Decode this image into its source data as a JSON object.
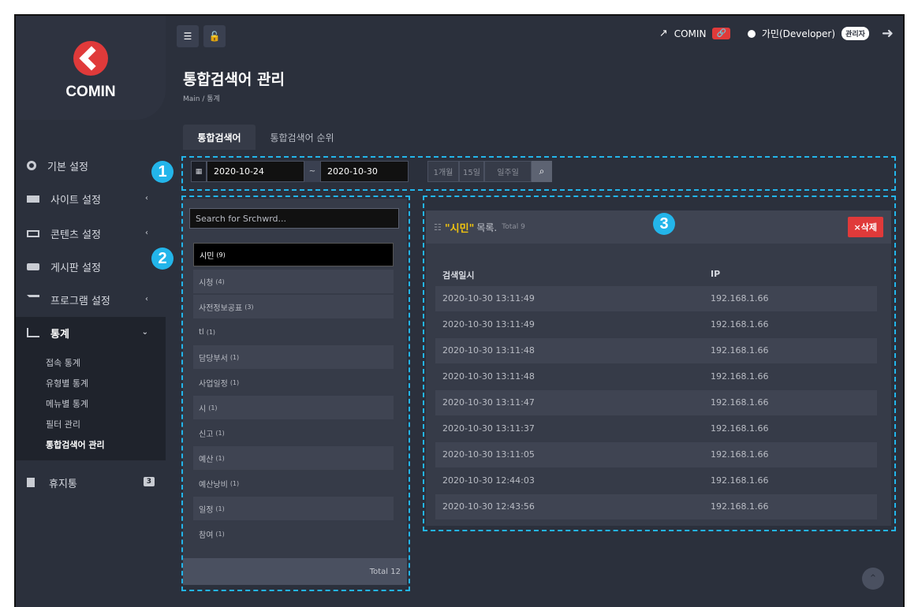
{
  "brand": {
    "name": "COMIN"
  },
  "sidebar": {
    "items": [
      {
        "label": "기본 설정"
      },
      {
        "label": "사이트 설정",
        "chevron": "‹"
      },
      {
        "label": "콘텐츠 설정",
        "chevron": "‹"
      },
      {
        "label": "게시판 설정"
      },
      {
        "label": "프로그램 설정",
        "chevron": "‹"
      },
      {
        "label": "통계",
        "chevron": "⌄"
      },
      {
        "label": "휴지통",
        "badge": "3"
      }
    ],
    "submenu": [
      "접속 통계",
      "유형별 통계",
      "메뉴별 통계",
      "필터 관리",
      "통합검색어 관리"
    ]
  },
  "topbar": {
    "site_link": "COMIN",
    "user_name": "가민(Developer)",
    "role": "관리자"
  },
  "page": {
    "title": "통합검색어 관리",
    "breadcrumb": "Main  /  통계"
  },
  "tabs": [
    "통합검색어",
    "통합검색어 순위"
  ],
  "filter": {
    "start_date": "2020-10-24",
    "separator": "~",
    "end_date": "2020-10-30",
    "ranges": [
      "1개월",
      "15일",
      "일주일"
    ]
  },
  "keyword_panel": {
    "search_placeholder": "Search for Srchwrd...",
    "items": [
      {
        "word": "시민",
        "count": "(9)"
      },
      {
        "word": "시청",
        "count": "(4)"
      },
      {
        "word": "사전정보공표",
        "count": "(3)"
      },
      {
        "word": "tl",
        "count": "(1)"
      },
      {
        "word": "담당부서",
        "count": "(1)"
      },
      {
        "word": "사업일정",
        "count": "(1)"
      },
      {
        "word": "시",
        "count": "(1)"
      },
      {
        "word": "신고",
        "count": "(1)"
      },
      {
        "word": "예산",
        "count": "(1)"
      },
      {
        "word": "예산낭비",
        "count": "(1)"
      },
      {
        "word": "일정",
        "count": "(1)"
      },
      {
        "word": "참여",
        "count": "(1)"
      }
    ],
    "footer_total": "Total 12"
  },
  "detail": {
    "keyword": "\"시민\"",
    "list_word": "목록.",
    "total": "Total 9",
    "delete_label": "×삭제",
    "columns": [
      "검색일시",
      "IP"
    ],
    "rows": [
      {
        "time": "2020-10-30 13:11:49",
        "ip": "192.168.1.66"
      },
      {
        "time": "2020-10-30 13:11:49",
        "ip": "192.168.1.66"
      },
      {
        "time": "2020-10-30 13:11:48",
        "ip": "192.168.1.66"
      },
      {
        "time": "2020-10-30 13:11:48",
        "ip": "192.168.1.66"
      },
      {
        "time": "2020-10-30 13:11:47",
        "ip": "192.168.1.66"
      },
      {
        "time": "2020-10-30 13:11:37",
        "ip": "192.168.1.66"
      },
      {
        "time": "2020-10-30 13:11:05",
        "ip": "192.168.1.66"
      },
      {
        "time": "2020-10-30 12:44:03",
        "ip": "192.168.1.66"
      },
      {
        "time": "2020-10-30 12:43:56",
        "ip": "192.168.1.66"
      }
    ]
  },
  "callouts": [
    "1",
    "2",
    "3"
  ],
  "colors": {
    "accent": "#23b5ea",
    "danger": "#e03a3a",
    "highlight": "#f1c40f",
    "background": "#2b303c"
  }
}
